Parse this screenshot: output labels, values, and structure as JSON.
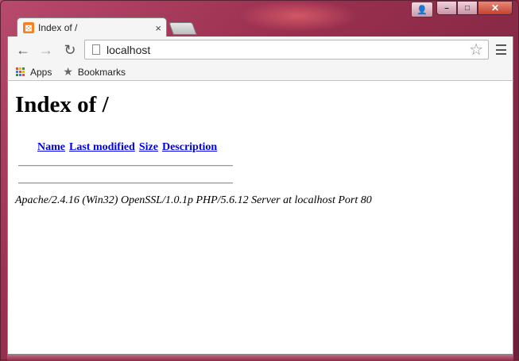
{
  "window": {
    "controls": {
      "minimize": "–",
      "maximize": "□",
      "close": "✕",
      "user": "👤"
    }
  },
  "tab": {
    "title": "Index of /",
    "favicon_glyph": "⊠",
    "close_glyph": "×"
  },
  "toolbar": {
    "back_glyph": "←",
    "forward_glyph": "→",
    "reload_glyph": "↻",
    "url": "localhost",
    "star_glyph": "☆"
  },
  "bookmarks": {
    "apps_label": "Apps",
    "bookmarks_label": "Bookmarks",
    "star_glyph": "★"
  },
  "page": {
    "heading": "Index of /",
    "columns": [
      "Name",
      "Last modified",
      "Size",
      "Description"
    ],
    "address": "Apache/2.4.16 (Win32) OpenSSL/1.0.1p PHP/5.6.12 Server at localhost Port 80"
  },
  "colors": {
    "link": "#0000ee",
    "favicon": "#f58220",
    "close_button": "#c6402d"
  }
}
